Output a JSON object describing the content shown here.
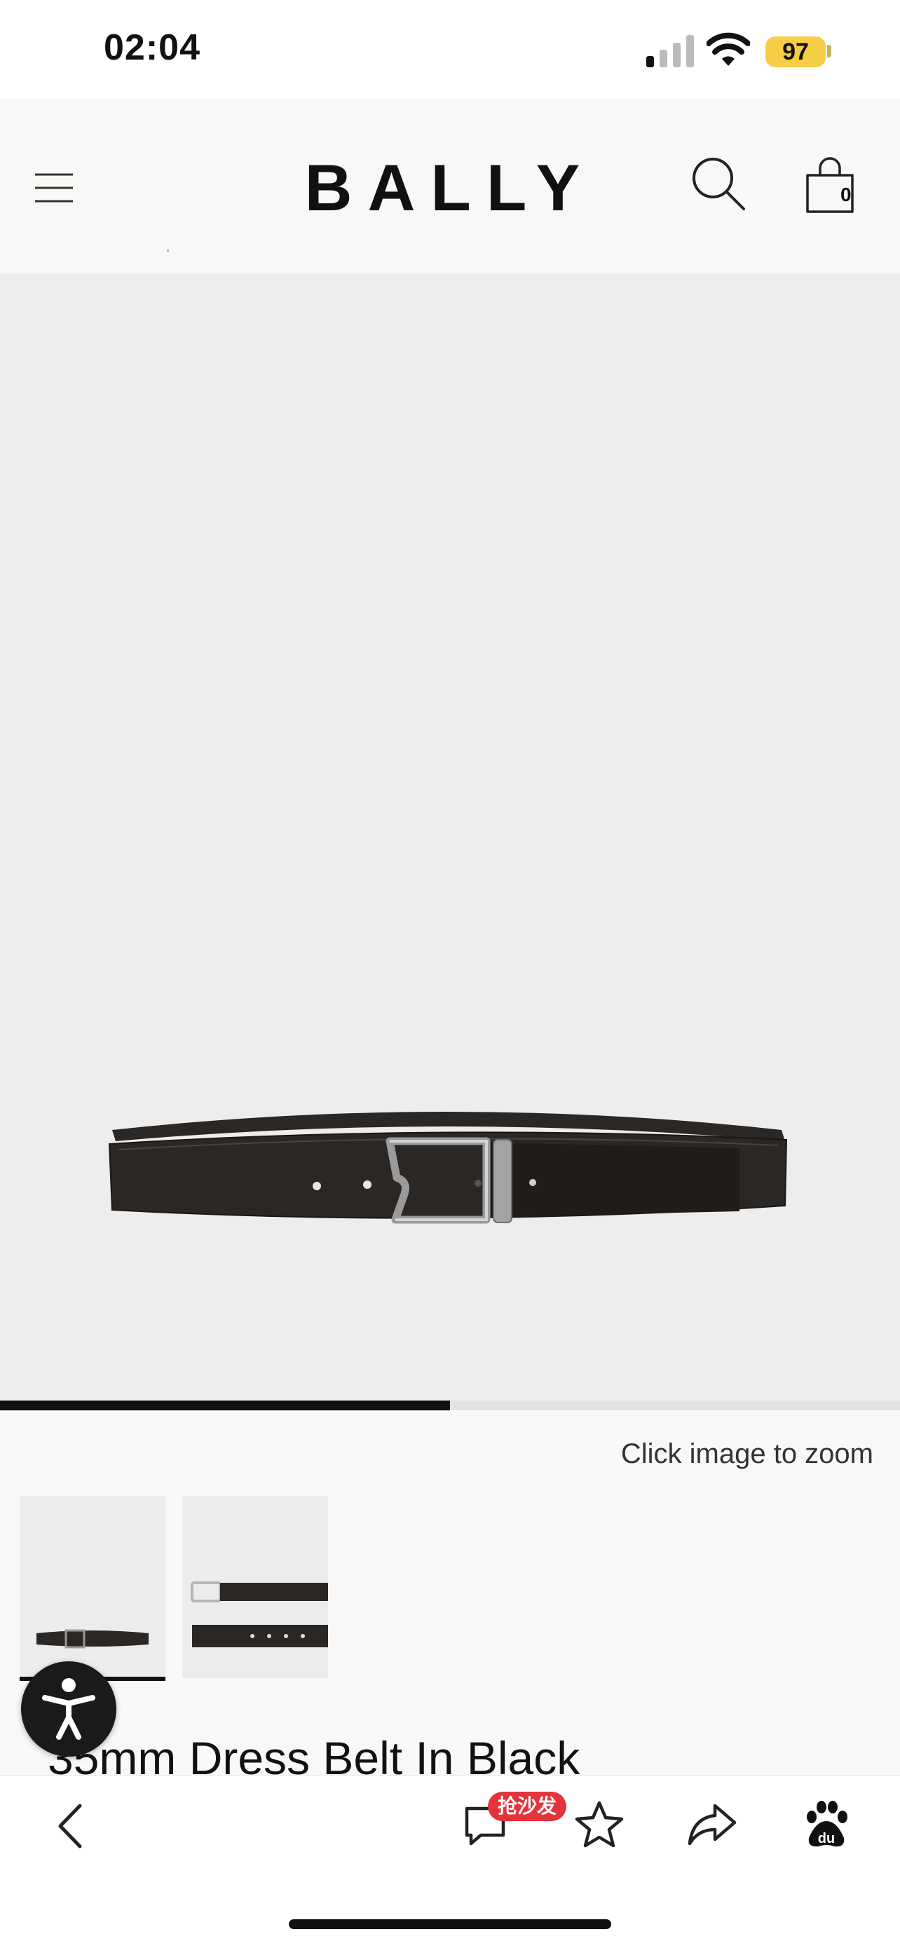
{
  "status_bar": {
    "time": "02:04",
    "battery": "97"
  },
  "header": {
    "logo_text": "BALLY",
    "bag_count": "0",
    "icons": [
      "menu-icon",
      "search-icon",
      "shopping-bag-icon"
    ]
  },
  "gallery": {
    "progress": 0.5,
    "zoom_hint": "Click image to zoom",
    "thumbnails": [
      "belt-front",
      "belt-reversible-detail"
    ]
  },
  "product": {
    "title": "35mm Dress Belt In Black"
  },
  "bottom_bar": {
    "comment_badge": "抢沙发",
    "icons": [
      "back-icon",
      "comment-icon",
      "star-icon",
      "share-icon",
      "baidu-icon"
    ]
  },
  "colors": {
    "header_bg": "#faf8f6",
    "image_bg": "#ededed",
    "battery": "#f5cd47",
    "badge": "#e3343c"
  }
}
